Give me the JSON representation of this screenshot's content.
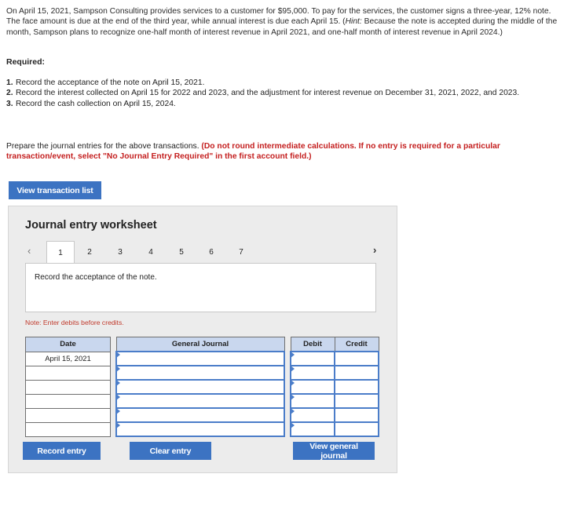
{
  "problem": {
    "text": "On April 15, 2021, Sampson Consulting provides services to a customer for $95,000. To pay for the services, the customer signs a three-year, 12% note. The face amount is due at the end of the third year, while annual interest is due each April 15. (",
    "hint_label": "Hint:",
    "hint_text": " Because the note is accepted during the middle of the month, Sampson plans to recognize one-half month of interest revenue in April 2021, and one-half month of interest revenue in April 2024.)"
  },
  "required": {
    "heading": "Required:",
    "items": [
      {
        "num": "1.",
        "text": "Record the acceptance of the note on April 15, 2021."
      },
      {
        "num": "2.",
        "text": "Record the interest collected on April 15 for 2022 and 2023, and the adjustment for interest revenue on December 31, 2021, 2022, and 2023."
      },
      {
        "num": "3.",
        "text": "Record the cash collection on April 15, 2024."
      }
    ]
  },
  "instructions": {
    "plain": "Prepare the journal entries for the above transactions. ",
    "bold_red": "(Do not round intermediate calculations. If no entry is required for a particular transaction/event, select \"No Journal Entry Required\" in the first account field.)"
  },
  "buttons": {
    "view_transaction_list": "View transaction list",
    "record_entry": "Record entry",
    "clear_entry": "Clear entry",
    "view_general_journal": "View general journal"
  },
  "worksheet": {
    "title": "Journal entry worksheet",
    "tabs": [
      "1",
      "2",
      "3",
      "4",
      "5",
      "6",
      "7"
    ],
    "active_tab": "1",
    "prev_icon": "‹",
    "next_icon": "›",
    "description": "Record the acceptance of the note.",
    "note": "Note: Enter debits before credits.",
    "table": {
      "headers": {
        "date": "Date",
        "general_journal": "General Journal",
        "debit": "Debit",
        "credit": "Credit"
      },
      "rows": [
        {
          "date": "April 15, 2021",
          "account": "",
          "debit": "",
          "credit": ""
        },
        {
          "date": "",
          "account": "",
          "debit": "",
          "credit": ""
        },
        {
          "date": "",
          "account": "",
          "debit": "",
          "credit": ""
        },
        {
          "date": "",
          "account": "",
          "debit": "",
          "credit": ""
        },
        {
          "date": "",
          "account": "",
          "debit": "",
          "credit": ""
        },
        {
          "date": "",
          "account": "",
          "debit": "",
          "credit": ""
        }
      ]
    }
  },
  "colors": {
    "accent": "#3c73c2",
    "header_fill": "#c9d7ee",
    "warning": "#c41f1f"
  }
}
